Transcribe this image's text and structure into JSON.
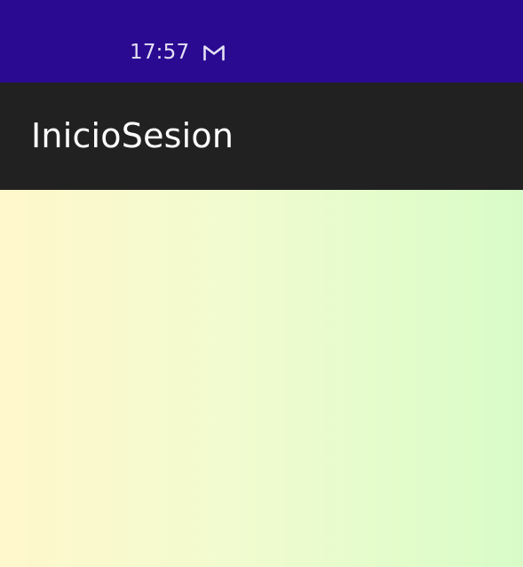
{
  "status_bar": {
    "time": "17:57",
    "notification_icon": "gmail-icon"
  },
  "app_bar": {
    "title": "InicioSesion"
  },
  "colors": {
    "status_bar": "#2a0a91",
    "app_bar": "#212121",
    "gradient_start": "#fff8cc",
    "gradient_end": "#d8fcc7"
  }
}
